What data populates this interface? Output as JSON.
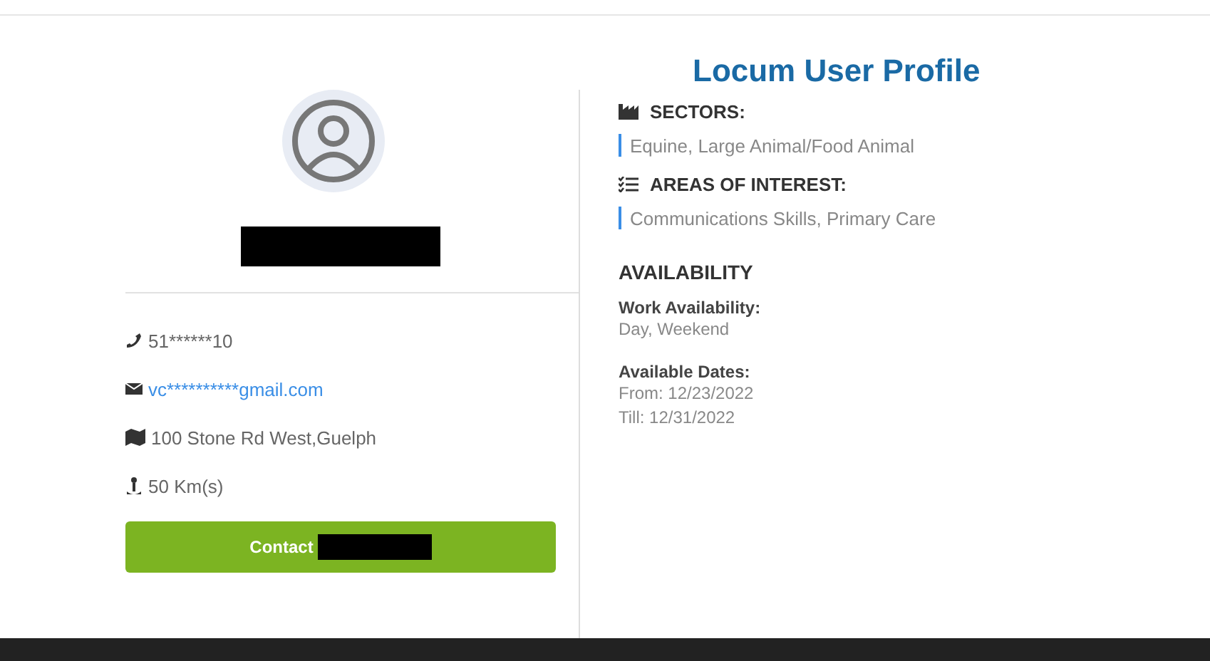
{
  "title": "Locum User Profile",
  "contacts": [
    {
      "kind": "phone",
      "text": "51******10"
    },
    {
      "kind": "email",
      "text": "vc**********gmail.com"
    },
    {
      "kind": "address",
      "text": "100 Stone Rd West,Guelph"
    },
    {
      "kind": "distance",
      "text": "50 Km(s)"
    }
  ],
  "contact_button": {
    "label": "Contact"
  },
  "sections": [
    {
      "kind": "sectors",
      "heading": "SECTORS:",
      "value": "Equine, Large Animal/Food Animal"
    },
    {
      "kind": "interests",
      "heading": "AREAS OF INTEREST:",
      "value": "Communications Skills, Primary Care"
    }
  ],
  "availability": {
    "heading": "AVAILABILITY",
    "groups": [
      {
        "label": "Work Availability:",
        "lines": [
          "Day, Weekend"
        ]
      },
      {
        "label": "Available Dates:",
        "lines": [
          "From: 12/23/2022",
          "Till: 12/31/2022"
        ]
      }
    ]
  }
}
